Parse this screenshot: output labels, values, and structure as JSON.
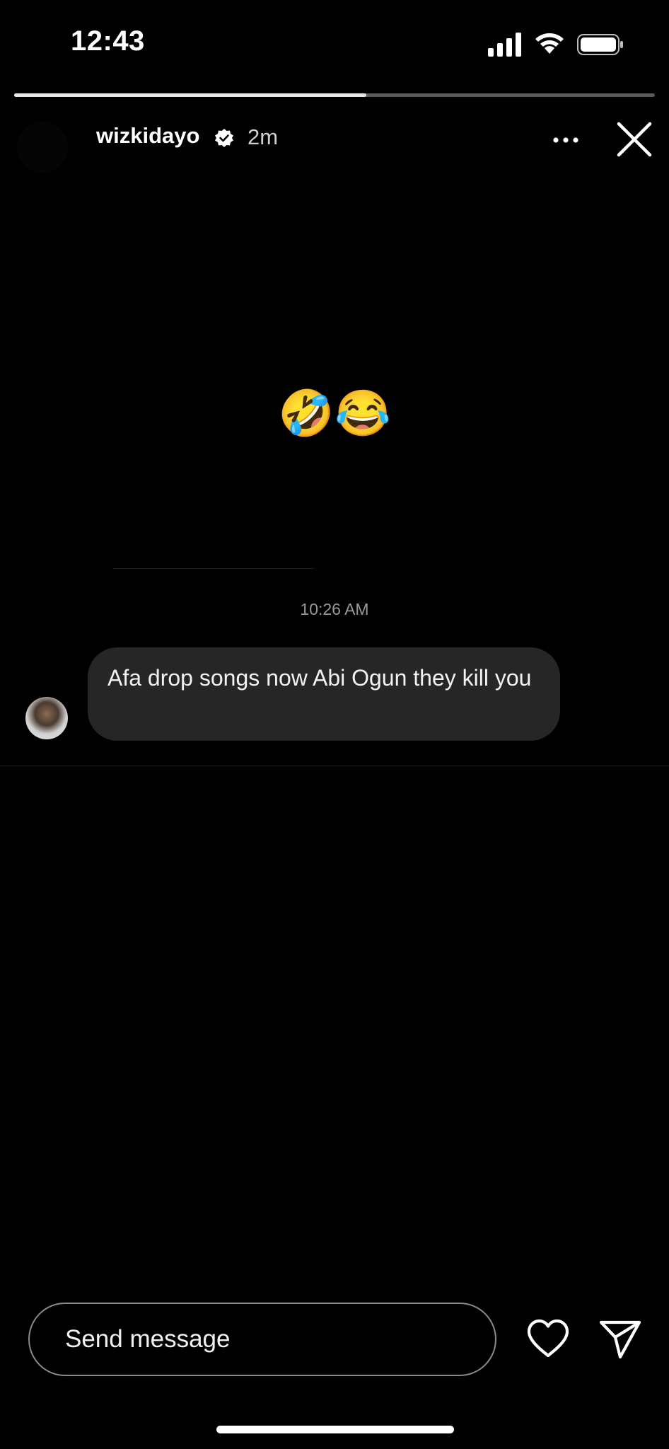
{
  "status_bar": {
    "time": "12:43",
    "icons": [
      "cellular-signal-icon",
      "wifi-icon",
      "battery-icon"
    ]
  },
  "story": {
    "progress_fraction": 0.55,
    "username": "wizkidayo",
    "verified": true,
    "age": "2m",
    "content_emojis": "🤣😂"
  },
  "message": {
    "timestamp": "10:26 AM",
    "text": "Afa drop songs now Abi Ogun they kill you"
  },
  "composer": {
    "placeholder": "Send message"
  },
  "colors": {
    "background": "#000000",
    "bubble": "#262626",
    "progress_track": "#5a5a5a",
    "progress_fill": "#e9e9e9"
  }
}
